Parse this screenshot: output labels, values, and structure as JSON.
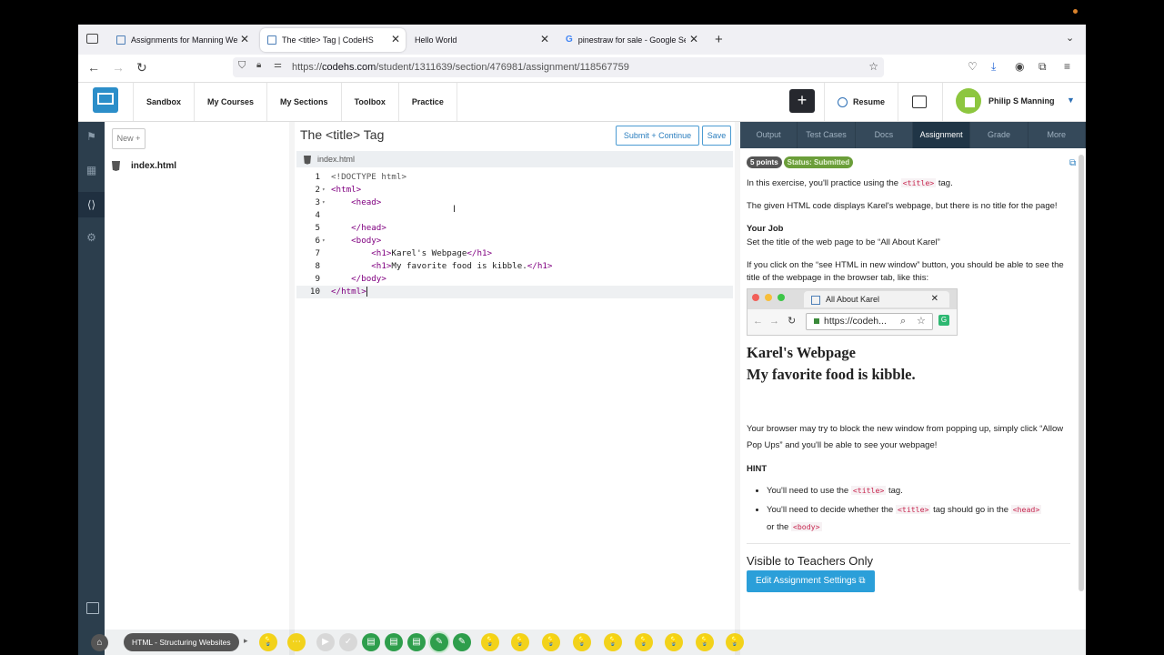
{
  "browser": {
    "tabs": [
      {
        "title": "Assignments for Manning Web D",
        "active": false
      },
      {
        "title": "The <title> Tag | CodeHS",
        "active": true
      },
      {
        "title": "Hello World",
        "active": false
      },
      {
        "title": "pinestraw for sale - Google Sea",
        "active": false
      }
    ],
    "url_prefix": "https://",
    "url_domain": "codehs.com",
    "url_path": "/student/1311639/section/476981/assignment/118567759"
  },
  "header": {
    "nav": [
      "Sandbox",
      "My Courses",
      "My Sections",
      "Toolbox",
      "Practice"
    ],
    "add_label": "+",
    "resume_label": "Resume",
    "user_name": "Philip S Manning"
  },
  "files": {
    "new_label": "New +",
    "items": [
      "index.html"
    ]
  },
  "editor": {
    "title": "The <title> Tag",
    "submit_label": "Submit + Continue",
    "save_label": "Save",
    "file_tab": "index.html",
    "lines": [
      {
        "n": "1",
        "fold": "",
        "text": "<!DOCTYPE html>"
      },
      {
        "n": "2",
        "fold": "▾",
        "text": "<html>"
      },
      {
        "n": "3",
        "fold": "▾",
        "text": "    <head>"
      },
      {
        "n": "4",
        "fold": "",
        "text": ""
      },
      {
        "n": "5",
        "fold": "",
        "text": "    </head>"
      },
      {
        "n": "6",
        "fold": "▾",
        "text": "    <body>"
      },
      {
        "n": "7",
        "fold": "",
        "text": "        <h1>Karel's Webpage</h1>"
      },
      {
        "n": "8",
        "fold": "",
        "text": "        <h1>My favorite food is kibble.</h1>"
      },
      {
        "n": "9",
        "fold": "",
        "text": "    </body>"
      },
      {
        "n": "10",
        "fold": "",
        "text": "</html>"
      }
    ]
  },
  "assignment": {
    "tabs": [
      "Output",
      "Test Cases",
      "Docs",
      "Assignment",
      "Grade",
      "More"
    ],
    "active_tab": "Assignment",
    "points": "5 points",
    "status": "Status: Submitted",
    "intro_a": "In this exercise, you'll practice using the ",
    "intro_code": "<title>",
    "intro_b": " tag.",
    "given": "The given HTML code displays Karel's webpage, but there is no title for the page!",
    "job_heading": "Your Job",
    "job_text": "Set the title of the web page to be “All About Karel”",
    "click_text": "If you click on the “see HTML in new window” button, you should be able to see the title of the webpage in the browser tab, like this:",
    "example": {
      "tab_title": "All About Karel",
      "url": "https://codeh..."
    },
    "sample_h1_a": "Karel's Webpage",
    "sample_h1_b": "My favorite food is kibble.",
    "popup_text": "Your browser may try to block the new window from popping up, simply click “Allow Pop Ups” and you'll be able to see your webpage!",
    "hint_heading": "HINT",
    "hint1_a": "You'll need to use the ",
    "hint1_code": "<title>",
    "hint1_b": " tag.",
    "hint2_a": "You'll need to decide whether the ",
    "hint2_code1": "<title>",
    "hint2_b": " tag should go in the ",
    "hint2_code2": "<head>",
    "hint2_c": "or the ",
    "hint2_code3": "<body>",
    "teachers_heading": "Visible to Teachers Only",
    "edit_label": "Edit Assignment Settings"
  },
  "bottombar": {
    "crumb": "HTML - Structuring Websites"
  },
  "colors": {
    "accent": "#2b9fd9",
    "dark_nav": "#35495a",
    "status_green": "#6b9e3a"
  }
}
